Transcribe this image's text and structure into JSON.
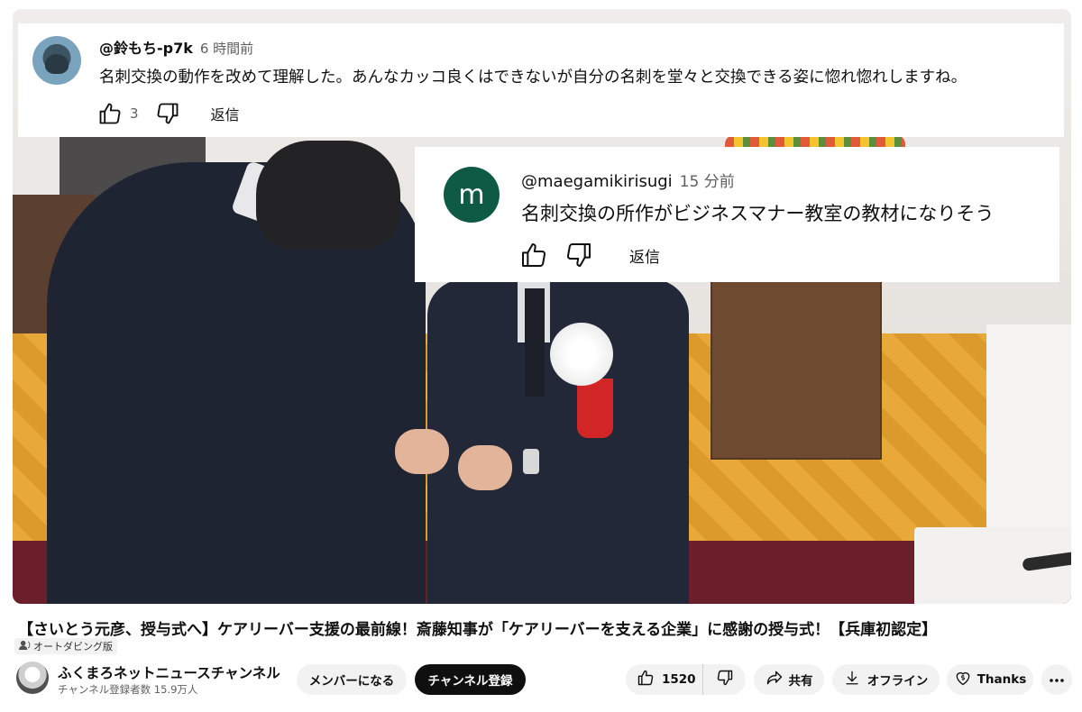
{
  "comments": [
    {
      "username": "@鈴もち-p7k",
      "time": "6 時間前",
      "text": "名刺交換の動作を改めて理解した。あんなカッコ良くはできないが自分の名刺を堂々と交換できる姿に惚れ惚れしますね。",
      "like_count": "3",
      "reply_label": "返信"
    },
    {
      "username": "@maegamikirisugi",
      "time": "15 分前",
      "avatar_letter": "m",
      "avatar_color": "#0f5a44",
      "text": "名刺交換の所作がビジネスマナー教室の教材になりそう",
      "reply_label": "返信"
    }
  ],
  "video": {
    "title": "【さいとう元彦、授与式へ】ケアリーバー支援の最前線！斎藤知事が「ケアリーバーを支える企業」に感謝の授与式！【兵庫初認定】",
    "badge": "オートダビング版"
  },
  "channel": {
    "name": "ふくまろネットニュースチャンネル",
    "subscribers": "チャンネル登録者数 15.9万人"
  },
  "actions": {
    "member_label": "メンバーになる",
    "subscribe_label": "チャンネル登録",
    "like_count": "1520",
    "share_label": "共有",
    "offline_label": "オフライン",
    "thanks_label": "Thanks"
  },
  "icons": {
    "like": "thumbs-up-icon",
    "dislike": "thumbs-down-icon",
    "share": "share-icon",
    "offline": "download-icon",
    "thanks": "thanks-icon",
    "more": "more-icon",
    "dub": "dub-icon"
  }
}
